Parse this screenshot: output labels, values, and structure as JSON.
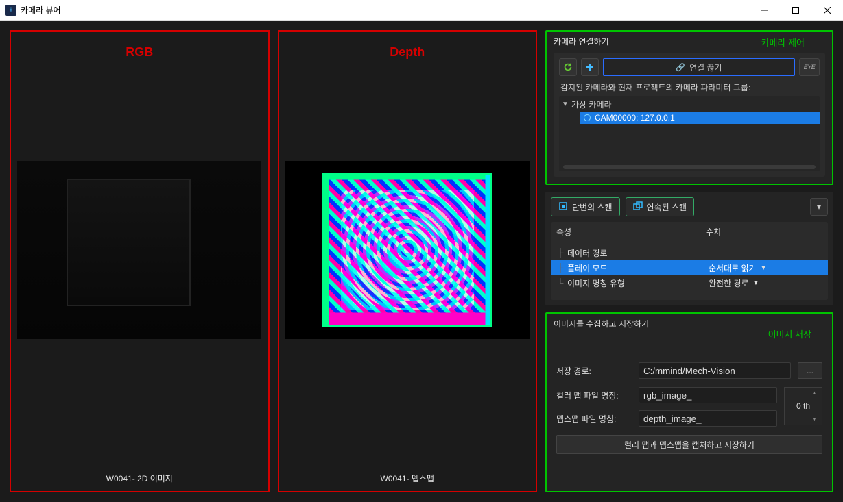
{
  "window": {
    "title": "카메라 뷰어"
  },
  "views": {
    "rgb": {
      "label": "RGB",
      "caption": "W0041-  2D 이미지"
    },
    "depth": {
      "label": "Depth",
      "caption": "W0041-  뎁스맵"
    }
  },
  "connect": {
    "panel_title": "카메라 연결하기",
    "annotation": "카메라 제어",
    "disconnect_label": "연결 끊기",
    "eye_label": "EYE",
    "detected_text": "감지된 카메라와 현재 프로젝트의 카메라 파라미터 그룹:",
    "tree": {
      "group": "가상 카메라",
      "item": "CAM00000: 127.0.0.1"
    }
  },
  "scan": {
    "single": "단번의 스캔",
    "continuous": "연속된 스캔"
  },
  "props": {
    "col_attr": "속성",
    "col_val": "수치",
    "rows": [
      {
        "name": "데이터 경로",
        "value": ""
      },
      {
        "name": "플레이 모드",
        "value": "순서대로 읽기"
      },
      {
        "name": "이미지 명칭 유형",
        "value": "완전한 경로"
      }
    ]
  },
  "save": {
    "panel_title": "이미지를 수집하고 저장하기",
    "annotation": "이미지 저장",
    "path_label": "저장 경로:",
    "path_value": "C:/mmind/Mech-Vision",
    "browse": "...",
    "color_label": "컬러 맵 파일 명칭:",
    "color_value": "rgb_image_",
    "depth_label": "뎁스맵 파일 명칭:",
    "depth_value": "depth_image_",
    "index_value": "0 th",
    "capture_btn": "컬러 맵과 뎁스맵을 캡처하고 저장하기"
  }
}
